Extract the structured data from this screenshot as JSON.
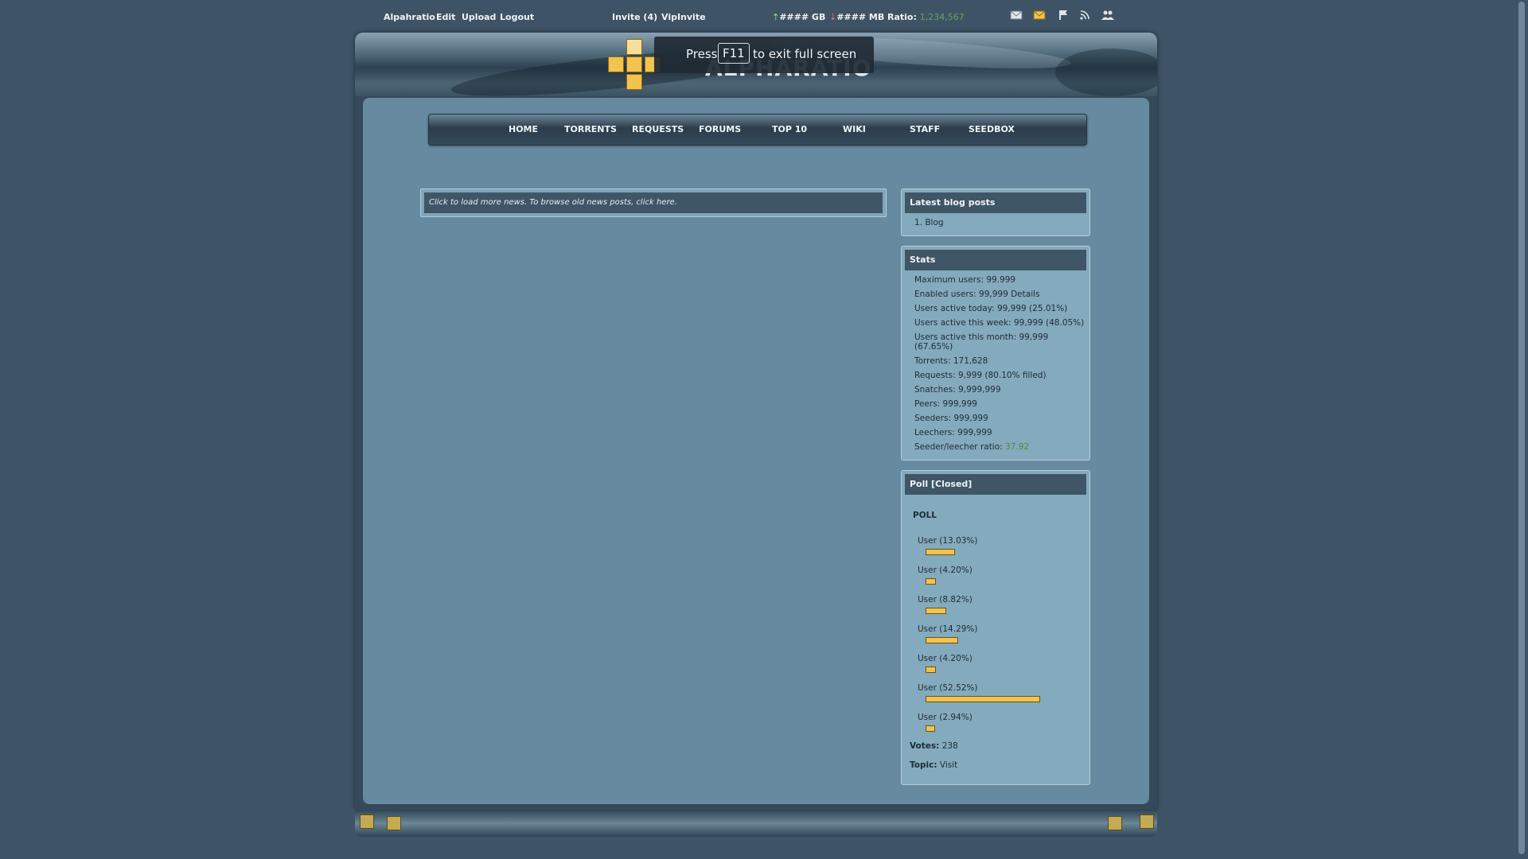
{
  "userbar": {
    "username": "Alpahratio",
    "edit": "Edit",
    "upload": "Upload",
    "logout": "Logout",
    "invite": "Invite (4)",
    "vipinvite": "VipInvite",
    "upload_arrow": "⇡",
    "upload_amount": "#### GB",
    "download_arrow": "⇣",
    "download_amount": "#### MB",
    "ratio_label": "Ratio:",
    "ratio_value": "1,234,567"
  },
  "header": {
    "logo_text": "ALPHARATIO"
  },
  "toast": {
    "press": "Press",
    "key": "F11",
    "message": "to exit full screen"
  },
  "nav": {
    "items": [
      "HOME",
      "TORRENTS",
      "REQUESTS",
      "FORUMS",
      "TOP 10",
      "WIKI",
      "STAFF",
      "SEEDBOX"
    ]
  },
  "news": {
    "load_more": "Click to load more news",
    "middle": ". To browse old news posts, ",
    "click_here": "click here",
    "end": "."
  },
  "blog": {
    "title": "Latest blog posts",
    "items": [
      "1. Blog"
    ]
  },
  "stats": {
    "title": "Stats",
    "rows": [
      "Maximum users: 99.999",
      "Enabled users: 99,999 Details",
      "Users active today: 99,999 (25.01%)",
      "Users active this week: 99,999 (48.05%)",
      "Users active this month: 99,999",
      "(67.65%)",
      "Torrents: 171,628",
      "Requests: 9,999 (80.10% filled)",
      "Snatches: 9,999,999",
      "Peers: 999,999",
      "Seeders: 999,999",
      "Leechers: 999,999"
    ],
    "ratio_label": "Seeder/leecher ratio: ",
    "ratio_value": "37.92"
  },
  "poll": {
    "title": "Poll [Closed]",
    "question": "POLL",
    "options": [
      {
        "label": "User (13.03%)",
        "percent": 13.03
      },
      {
        "label": "User (4.20%)",
        "percent": 4.2
      },
      {
        "label": "User (8.82%)",
        "percent": 8.82
      },
      {
        "label": "User (14.29%)",
        "percent": 14.29
      },
      {
        "label": "User (4.20%)",
        "percent": 4.2
      },
      {
        "label": "User (52.52%)",
        "percent": 52.52
      },
      {
        "label": "User (2.94%)",
        "percent": 2.94
      }
    ],
    "votes_label": "Votes:",
    "votes_value": " 238",
    "topic_label": "Topic:",
    "topic_value": " Visit"
  },
  "colors": {
    "accent": "#f2c34f",
    "background": "#3e5466",
    "panel": "#668ba0"
  }
}
